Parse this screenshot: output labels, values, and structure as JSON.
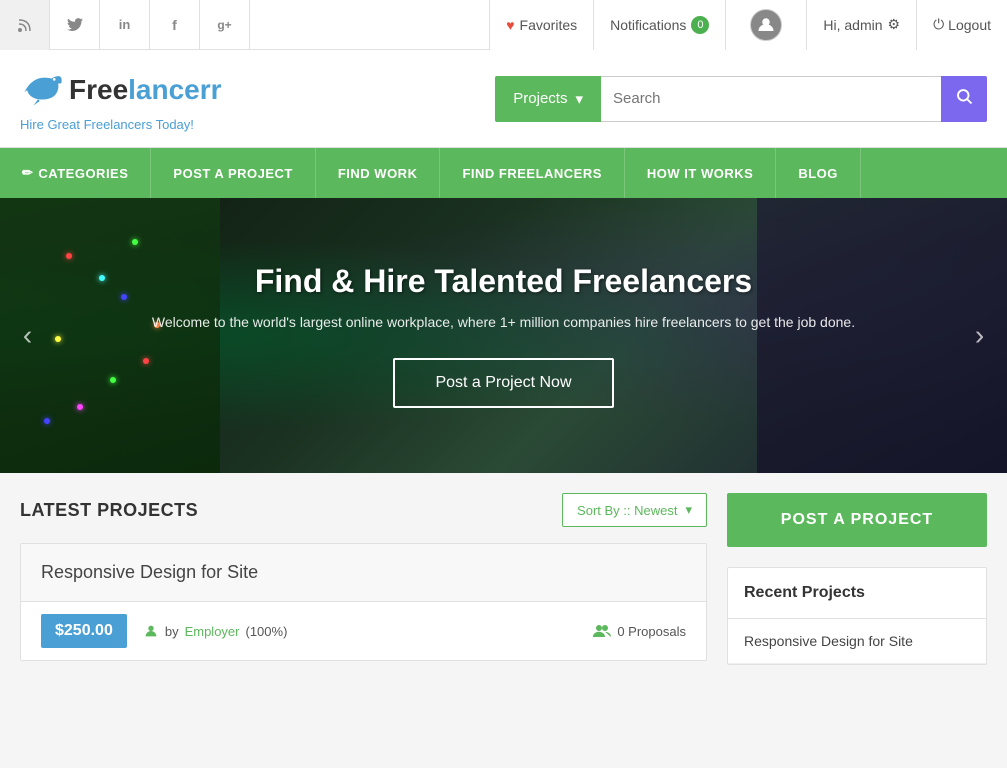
{
  "topbar": {
    "social": [
      {
        "name": "rss",
        "icon": "⊕",
        "symbol": "▣"
      },
      {
        "name": "twitter",
        "icon": "🐦"
      },
      {
        "name": "linkedin",
        "icon": "in"
      },
      {
        "name": "facebook",
        "icon": "f"
      },
      {
        "name": "google-plus",
        "icon": "g+"
      }
    ],
    "favorites_label": "Favorites",
    "notifications_label": "Notifications",
    "notifications_count": "0",
    "hi_admin_label": "Hi, admin",
    "logout_label": "Logout"
  },
  "header": {
    "logo_text_1": "Free",
    "logo_text_2": "lancerr",
    "tagline": "Hire Great Freelancers Today!",
    "projects_btn": "Projects",
    "search_placeholder": "Search"
  },
  "nav": {
    "items": [
      {
        "label": "CATEGORIES",
        "icon": "✏"
      },
      {
        "label": "POST A PROJECT",
        "icon": ""
      },
      {
        "label": "FIND WORK",
        "icon": ""
      },
      {
        "label": "FIND FREELANCERS",
        "icon": ""
      },
      {
        "label": "HOW IT WORKS",
        "icon": ""
      },
      {
        "label": "BLOG",
        "icon": ""
      }
    ]
  },
  "hero": {
    "title": "Find & Hire Talented Freelancers",
    "subtitle": "Welcome to the world's largest online workplace, where 1+ million companies hire freelancers to get the job done.",
    "cta_label": "Post a Project Now"
  },
  "latest_projects": {
    "section_title": "LATEST PROJECTS",
    "sort_label": "Sort By :: Newest",
    "project": {
      "title": "Responsive Design for Site",
      "price": "$250.00",
      "author_prefix": "by",
      "author_name": "Employer",
      "author_percent": "(100%)",
      "proposals_count": "0 Proposals"
    }
  },
  "right_column": {
    "post_btn_label": "POST A PROJECT",
    "recent_title": "Recent Projects",
    "recent_items": [
      {
        "title": "Responsive Design for Site"
      }
    ]
  }
}
